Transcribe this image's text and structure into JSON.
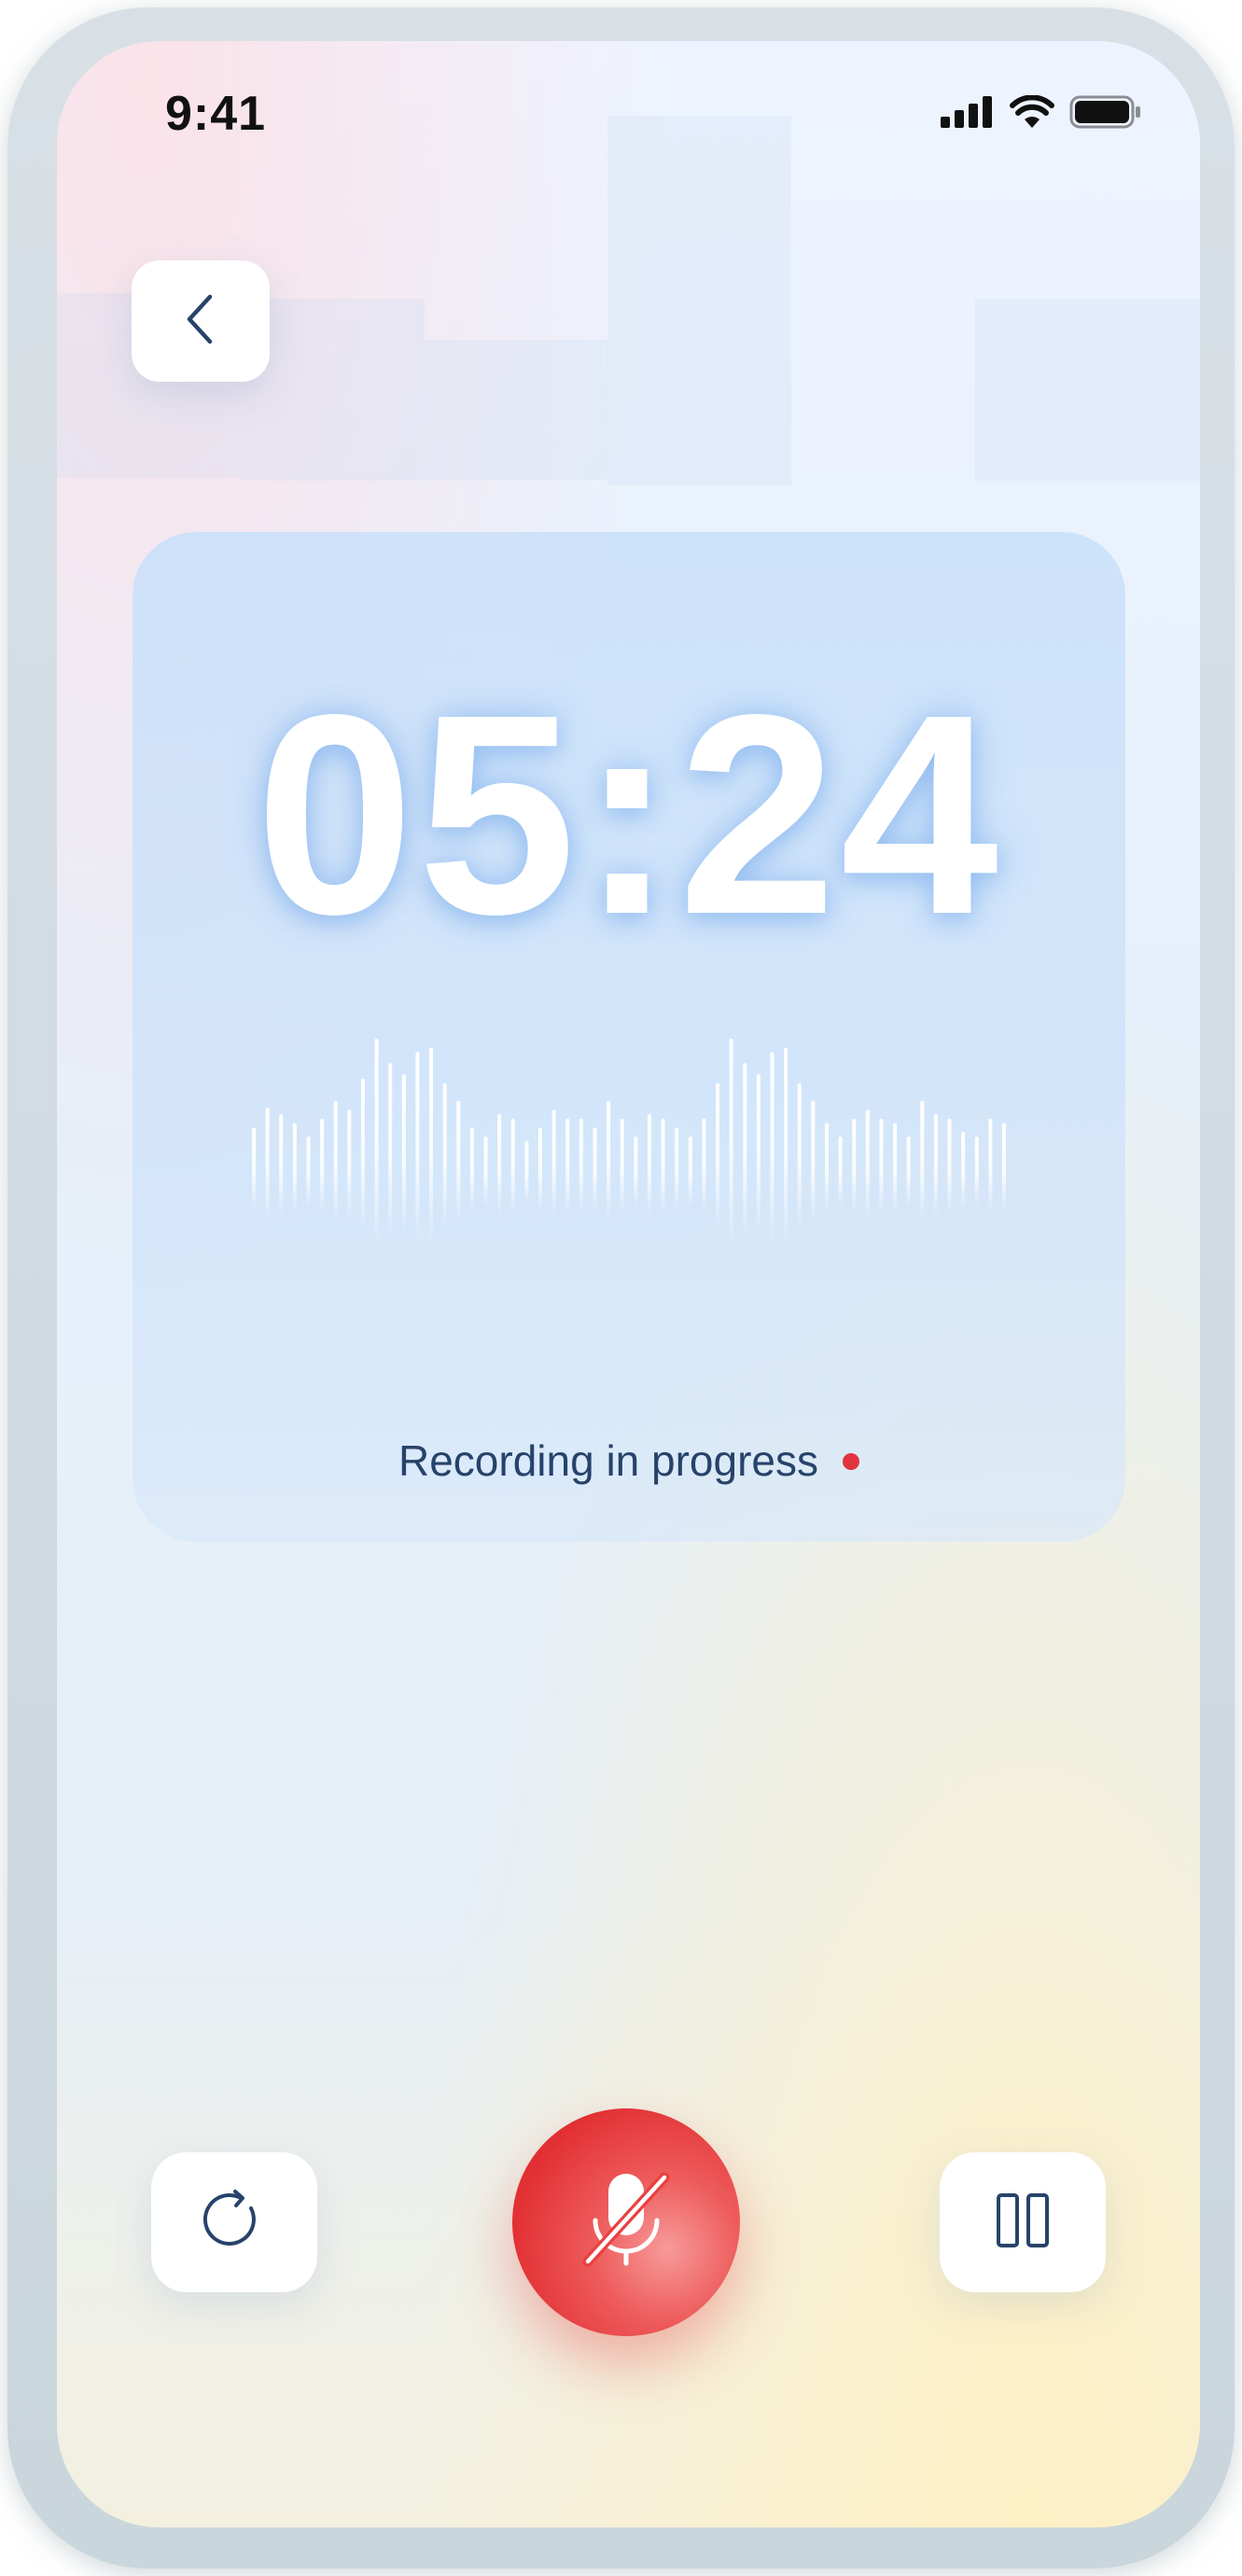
{
  "status_bar": {
    "time": "9:41",
    "icons": [
      "cellular-signal-icon",
      "wifi-icon",
      "battery-icon"
    ]
  },
  "nav": {
    "back_icon": "chevron-left-icon"
  },
  "recorder": {
    "timer": "05:24",
    "status_text": "Recording in progress",
    "status_indicator_color": "#e0343f",
    "waveform_levels": [
      0.26,
      0.35,
      0.32,
      0.28,
      0.22,
      0.3,
      0.38,
      0.34,
      0.48,
      0.66,
      0.55,
      0.5,
      0.6,
      0.62,
      0.46,
      0.38,
      0.26,
      0.22,
      0.32,
      0.3,
      0.2,
      0.26,
      0.34,
      0.3,
      0.3,
      0.26,
      0.38,
      0.3,
      0.22,
      0.32,
      0.3,
      0.26,
      0.22,
      0.3,
      0.46,
      0.66,
      0.55,
      0.5,
      0.6,
      0.62,
      0.46,
      0.38,
      0.28,
      0.22,
      0.3,
      0.34,
      0.3,
      0.28,
      0.22,
      0.38,
      0.32,
      0.3,
      0.24,
      0.22,
      0.3,
      0.28
    ]
  },
  "controls": {
    "reset_icon": "refresh-icon",
    "mic_icon": "mic-off-icon",
    "pause_icon": "pause-icon"
  },
  "colors": {
    "accent_red": "#e22f33",
    "text_dark": "#27436b",
    "card_tint": "#cde2fa"
  }
}
